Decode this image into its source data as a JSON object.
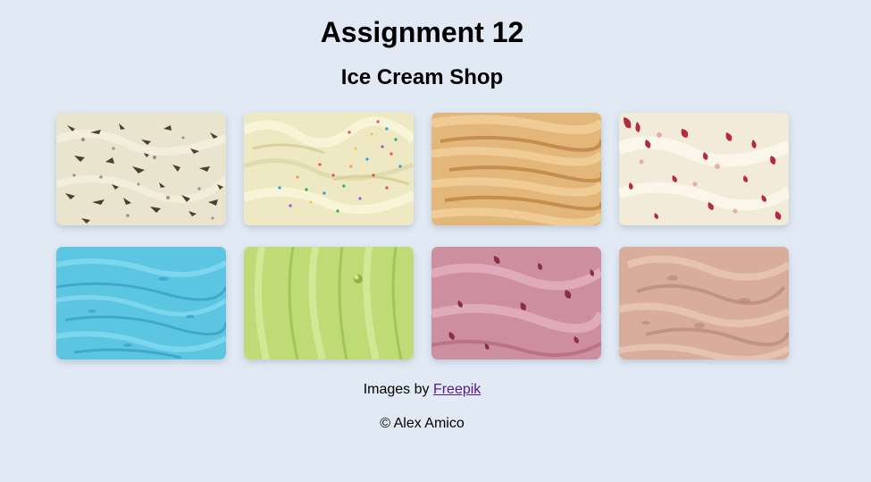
{
  "header": {
    "title": "Assignment 12",
    "subtitle": "Ice Cream Shop"
  },
  "gallery": {
    "items": [
      {
        "flavor": "cookies-and-cream",
        "base": "#e8e3cc",
        "accent": "#5a4a38"
      },
      {
        "flavor": "vanilla-sprinkles",
        "base": "#eee9c0",
        "accent": "#d8d49c"
      },
      {
        "flavor": "caramel",
        "base": "#e4b97c",
        "accent": "#c9934f"
      },
      {
        "flavor": "strawberry-cheesecake",
        "base": "#f1ead9",
        "accent": "#b32c3c"
      },
      {
        "flavor": "blue-moon",
        "base": "#5cc7e3",
        "accent": "#3aa7cb"
      },
      {
        "flavor": "pistachio",
        "base": "#bfdc78",
        "accent": "#9fc253"
      },
      {
        "flavor": "black-cherry",
        "base": "#cc8c9e",
        "accent": "#8e3444"
      },
      {
        "flavor": "chocolate",
        "base": "#d9ad9c",
        "accent": "#bb8a78"
      }
    ]
  },
  "footer": {
    "credit_prefix": "Images by",
    "credit_link": "Freepik",
    "copyright": "© Alex Amico"
  },
  "colors": {
    "background": "#e1eaf4",
    "link": "#551a8b"
  }
}
